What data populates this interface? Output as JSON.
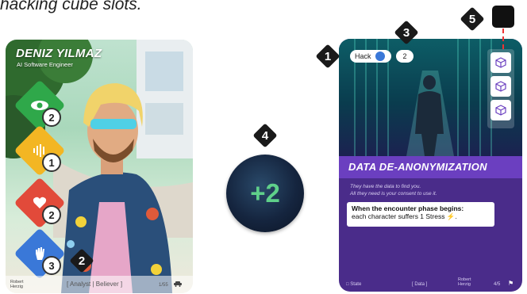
{
  "caption": "hacking cube slots.",
  "character_card": {
    "name": "DENIZ YILMAZ",
    "role": "AI Software Engineer",
    "stats": [
      {
        "icon": "eye-icon",
        "value": "2",
        "color": "#2fa84a"
      },
      {
        "icon": "sound-wave-icon",
        "value": "1",
        "color": "#f3b623"
      },
      {
        "icon": "heart-icon",
        "value": "2",
        "color": "#e24a3a"
      },
      {
        "icon": "hand-icon",
        "value": "3",
        "color": "#3a78d8"
      }
    ],
    "author": "Robert Herzig",
    "traits": "[ Analyst | Believer ]",
    "card_number": "1/55"
  },
  "token": {
    "value": "+2"
  },
  "encounter_card": {
    "skill_label": "Hack",
    "skill_value": "2",
    "title": "DATA DE-ANONYMIZATION",
    "flavor_line1": "They have the data to find you.",
    "flavor_line2": "All they need is your consent to use it.",
    "rule_heading": "When the encounter phase begins:",
    "rule_body": "each character suffers 1 Stress",
    "footer_left": "State",
    "footer_mid": "[ Data ]",
    "footer_author": "Robert Herzig",
    "footer_num": "4/5"
  },
  "markers": {
    "m1": "1",
    "m2": "2",
    "m3": "3",
    "m4": "4",
    "m5": "5"
  }
}
